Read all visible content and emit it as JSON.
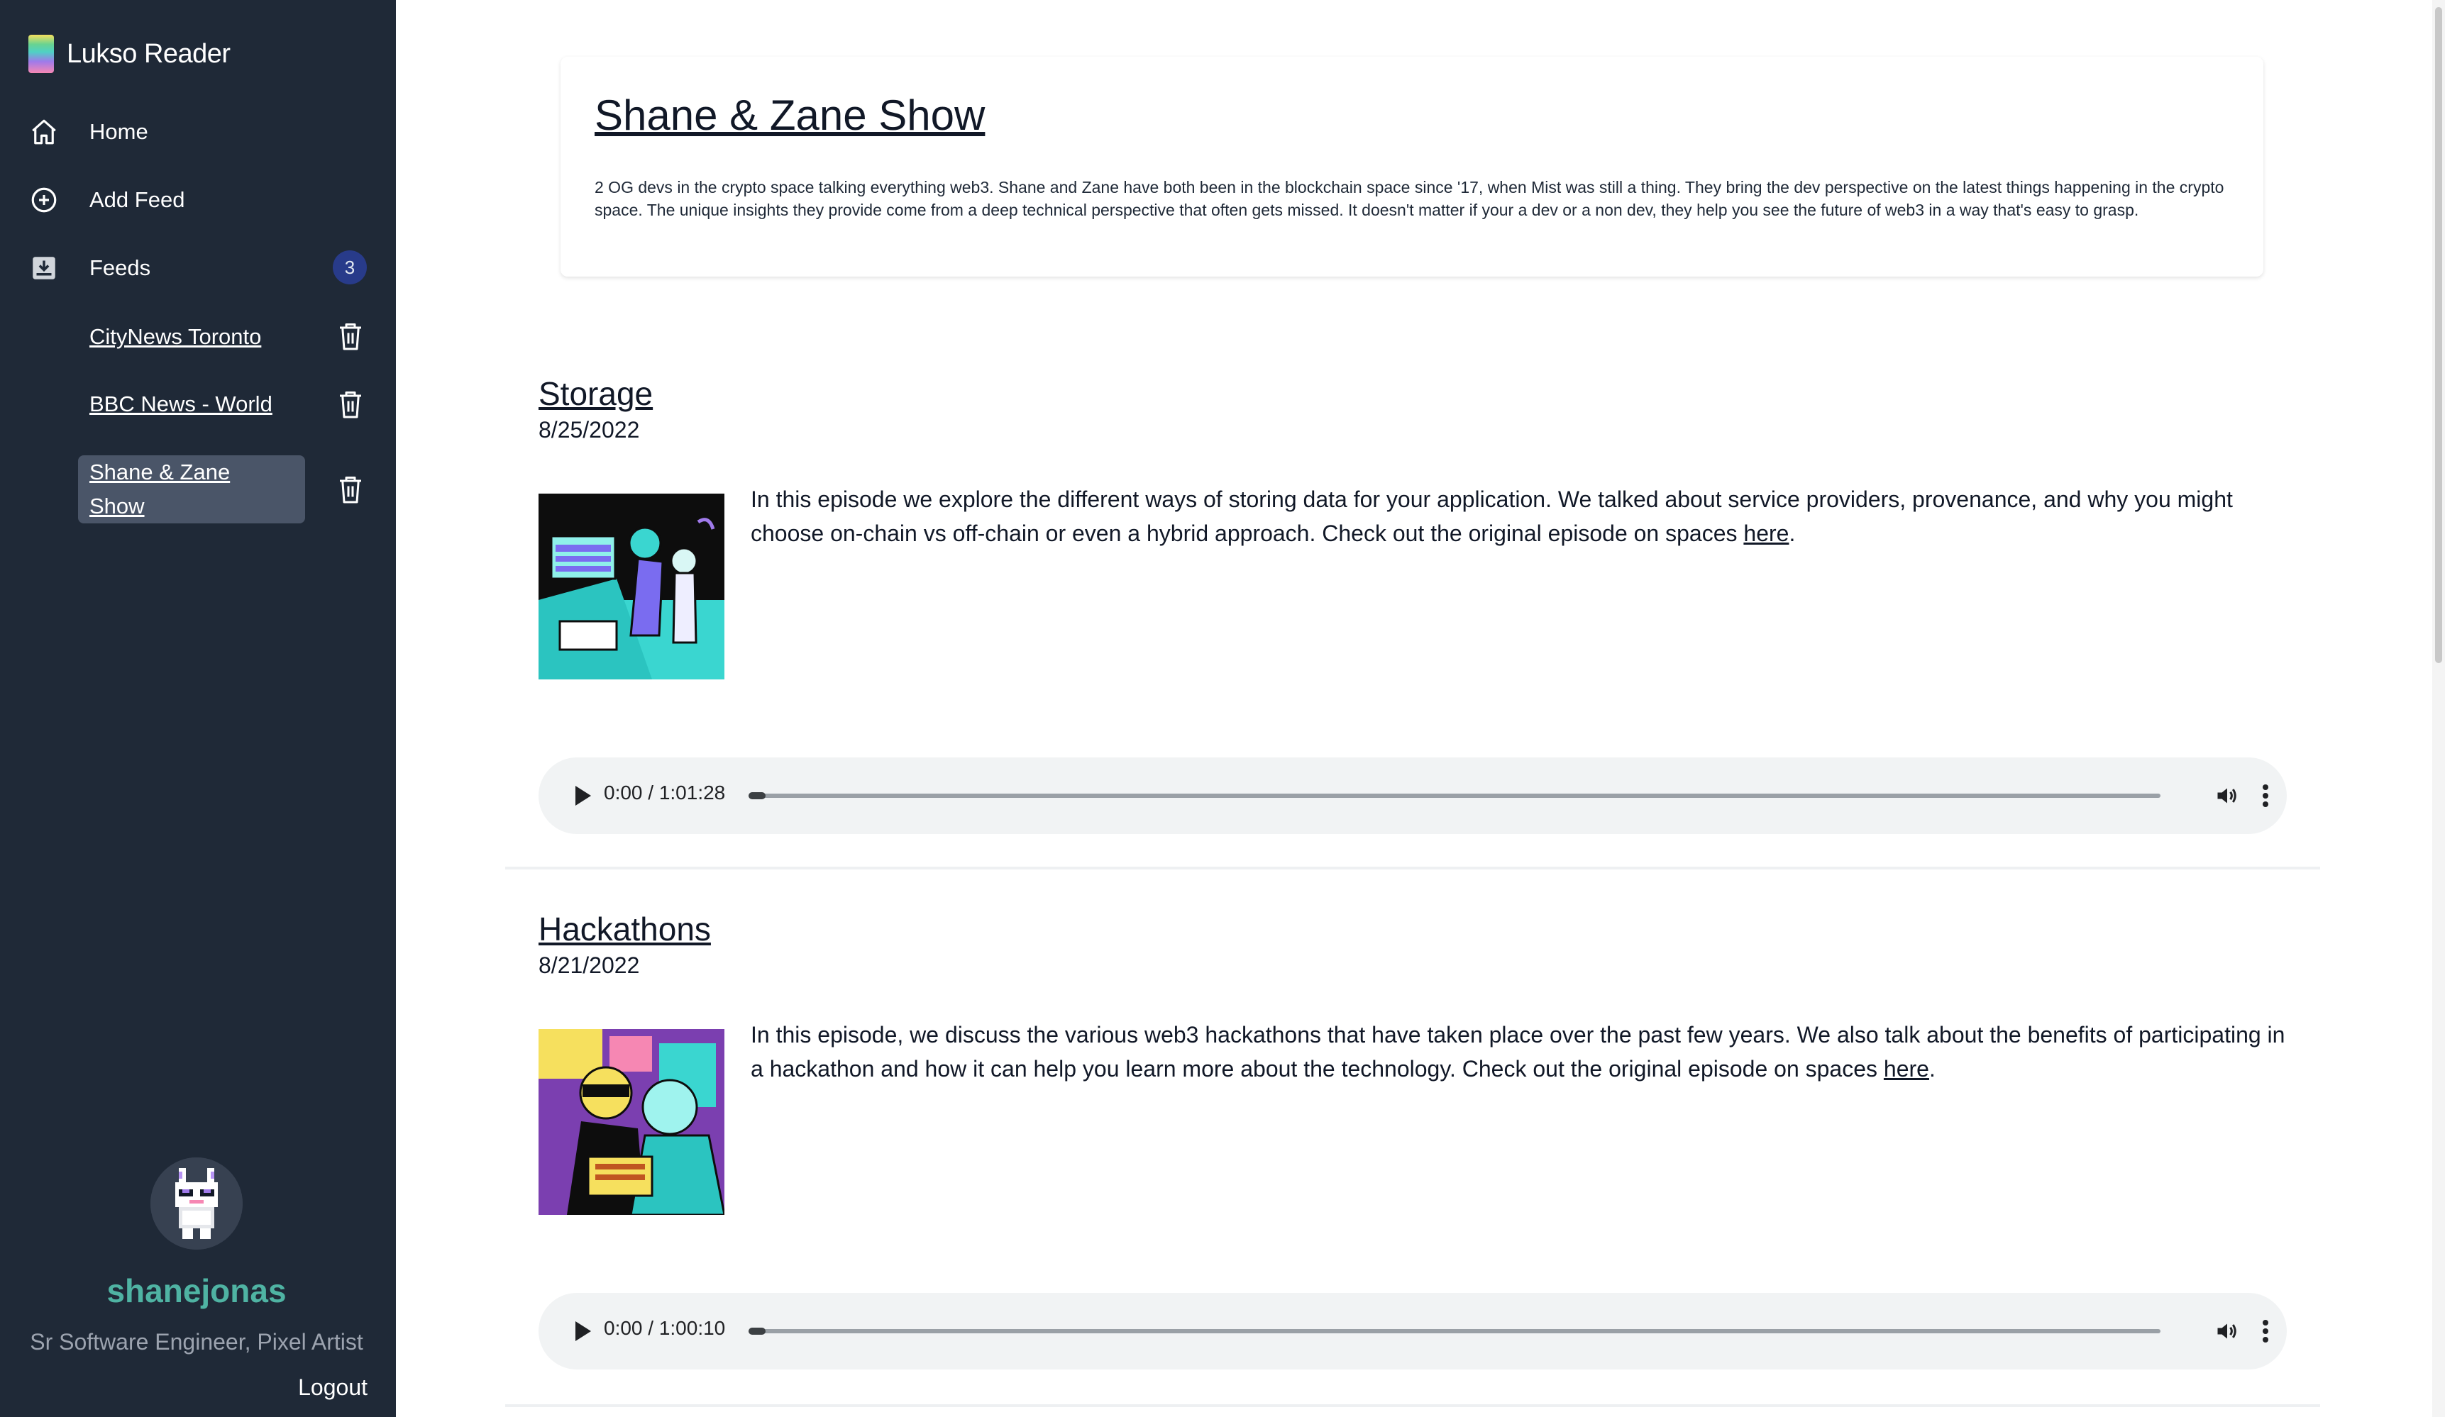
{
  "sidebar": {
    "brand": "Lukso Reader",
    "nav": {
      "home": "Home",
      "add_feed": "Add Feed",
      "feeds": "Feeds",
      "feeds_count": "3"
    },
    "feeds": [
      {
        "label": "CityNews Toronto"
      },
      {
        "label": "BBC News - World"
      },
      {
        "label": "Shane & Zane Show"
      }
    ],
    "profile": {
      "username": "shanejonas",
      "title": "Sr Software Engineer, Pixel Artist",
      "logout": "Logout"
    }
  },
  "show": {
    "title": "Shane & Zane Show",
    "description": "2 OG devs in the crypto space talking everything web3. Shane and Zane have both been in the blockchain space since '17, when Mist was still a thing. They bring the dev perspective on the latest things happening in the crypto space. The unique insights they provide come from a deep technical perspective that often gets missed. It doesn't matter if your a dev or a non dev, they help you see the future of web3 in a way that's easy to grasp."
  },
  "episodes": [
    {
      "title": "Storage",
      "date": "8/25/2022",
      "description": "In this episode we explore the different ways of storing data for your application. We talked about service providers, provenance, and why you might choose on-chain vs off-chain or even a hybrid approach.  Check out the original episode on spaces ",
      "link": "here",
      "suffix": ".",
      "time": "0:00 / 1:01:28",
      "progress": 0
    },
    {
      "title": "Hackathons",
      "date": "8/21/2022",
      "description": "In this episode, we discuss the various web3 hackathons that have taken place over the past few years. We also talk about the benefits of participating in a hackathon and how it can help you learn more about the technology. Check out the original episode on spaces ",
      "link": "here",
      "suffix": ".",
      "time": "0:00 / 1:00:10",
      "progress": 0
    }
  ],
  "colors": {
    "sidebar_bg": "#1f2937",
    "badge_bg": "#283b8a",
    "username": "#4fb3a3",
    "active_feed_bg": "#4a5568",
    "player_bg": "#f1f3f4"
  },
  "icons": [
    "home-icon",
    "plus-circle-icon",
    "inbox-download-icon",
    "trash-icon",
    "play-icon",
    "volume-icon",
    "more-vertical-icon"
  ]
}
